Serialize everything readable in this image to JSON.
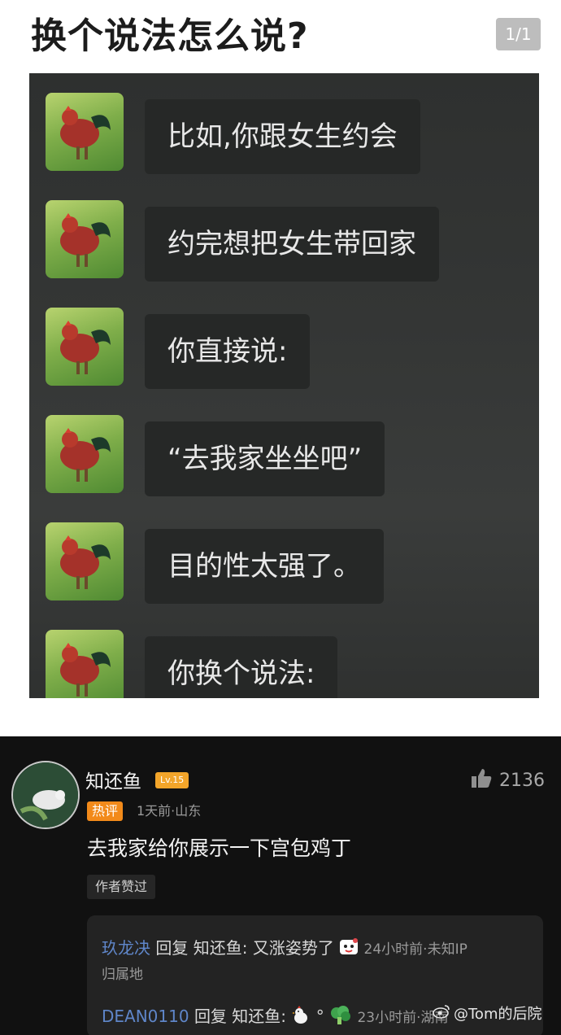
{
  "post": {
    "title": "换个说法怎么说?",
    "page_indicator": "1/1",
    "meme_messages": [
      "比如,你跟女生约会",
      "约完想把女生带回家",
      "你直接说:",
      "“去我家坐坐吧”",
      "目的性太强了。",
      "你换个说法:"
    ]
  },
  "comment": {
    "username": "知还鱼",
    "level": "Lv.15",
    "likes": "2136",
    "hot_badge": "热评",
    "meta": "1天前·山东",
    "text": "去我家给你展示一下宫包鸡丁",
    "author_liked": "作者赞过",
    "replies": [
      {
        "name": "玖龙决",
        "reply_word": "回复",
        "target": "知还鱼:",
        "text": "又涨姿势了",
        "meta_line1": "24小时前·未知IP",
        "meta_line2": "归属地"
      },
      {
        "name": "DEAN0110",
        "reply_word": "回复",
        "target": "知还鱼:",
        "text": "°",
        "meta": "23小时前·湖南"
      }
    ]
  },
  "watermark": "@Tom的后院",
  "colors": {
    "hot_badge": "#f28a1a",
    "level_badge": "#f3a52a",
    "reply_name": "#5f86c9",
    "comment_bg": "#111111"
  }
}
